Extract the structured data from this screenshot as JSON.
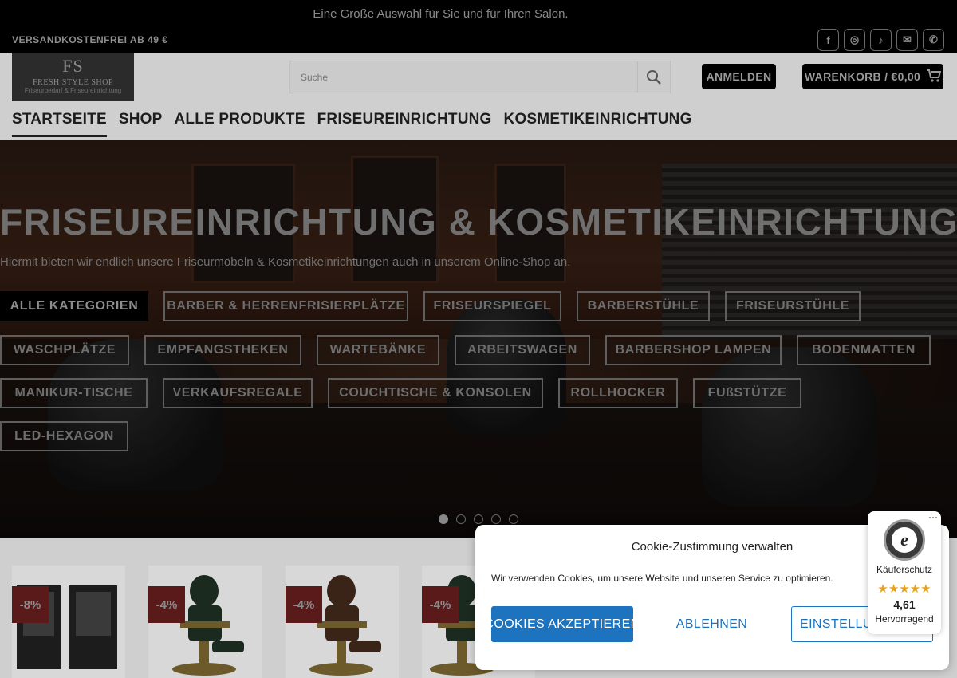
{
  "topbar": {
    "announcement": "Eine Große Auswahl für Sie und für Ihren Salon.",
    "shipping": "VERSANDKOSTENFREI AB 49 €",
    "social": [
      {
        "icon": "facebook-icon",
        "glyph": "f"
      },
      {
        "icon": "instagram-icon",
        "glyph": "◎"
      },
      {
        "icon": "tiktok-icon",
        "glyph": "♪"
      },
      {
        "icon": "email-icon",
        "glyph": "✉"
      },
      {
        "icon": "phone-icon",
        "glyph": "✆"
      }
    ]
  },
  "header": {
    "logo": {
      "mark": "FS",
      "name": "FRESH STYLE SHOP",
      "sub": "Friseurbedarf & Friseureinrichtung"
    },
    "search_placeholder": "Suche",
    "login_label": "ANMELDEN",
    "cart_label": "WARENKORB / €0,00",
    "nav": [
      "STARTSEITE",
      "SHOP",
      "ALLE PRODUKTE",
      "FRISEUREINRICHTUNG",
      "KOSMETIKEINRICHTUNG"
    ]
  },
  "hero": {
    "title": "FRISEUREINRICHTUNG & KOSMETIKEINRICHTUNG",
    "lead": "Hiermit bieten wir endlich unsere Friseurmöbeln & Kosmetikeinrichtungen auch in unserem Online-Shop an.",
    "categories": [
      "ALLE KATEGORIEN",
      "BARBER & HERRENFRISIERPLÄTZE",
      "FRISEURSPIEGEL",
      "BARBERSTÜHLE",
      "FRISEURSTÜHLE",
      "WASCHPLÄTZE",
      "EMPFANGSTHEKEN",
      "WARTEBÄNKE",
      "ARBEITSWAGEN",
      "BARBERSHOP LAMPEN",
      "BODENMATTEN",
      "MANIKUR-TISCHE",
      "VERKAUFSREGALE",
      "COUCHTISCHE & KONSOLEN",
      "ROLLHOCKER",
      "FUßSTÜTZE",
      "LED-HEXAGON"
    ],
    "slide_count": 5,
    "active_slide": 1
  },
  "products": {
    "badges": [
      "-8%",
      "-4%",
      "-4%",
      "-4%"
    ]
  },
  "cookie": {
    "title": "Cookie-Zustimmung verwalten",
    "text": "Wir verwenden Cookies, um unsere Website und unseren Service zu optimieren.",
    "accept": "COOKIES AKZEPTIEREN",
    "deny": "ABLEHNEN",
    "settings": "EINSTELLUNGEN SPEICHERN"
  },
  "trust": {
    "more": "···",
    "label": "Käuferschutz",
    "stars": "★★★★★",
    "score": "4,61",
    "rating": "Hervorragend"
  }
}
